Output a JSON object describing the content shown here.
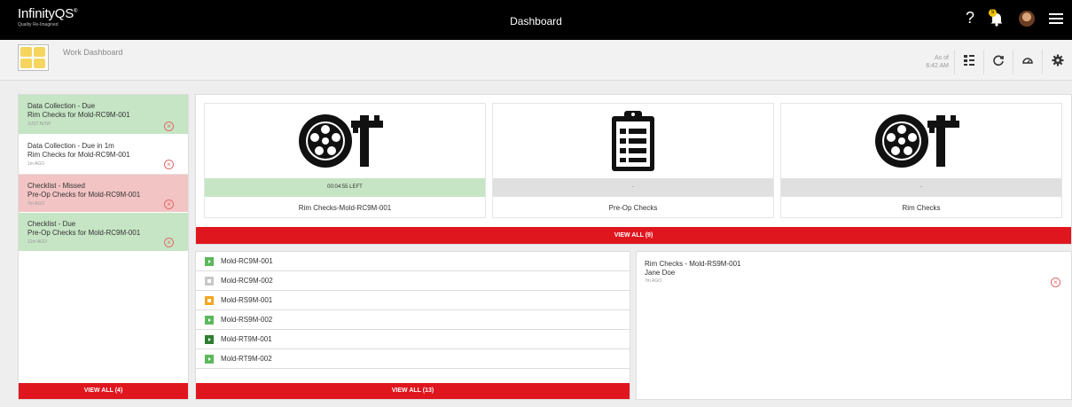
{
  "header": {
    "brand": "InfinityQS",
    "brand_mark": "®",
    "tagline": "Quality Re-Imagined",
    "title": "Dashboard",
    "help": "?",
    "notification_count": "5"
  },
  "toolbar": {
    "dashboard_name": "Work Dashboard",
    "as_of_label": "As of",
    "as_of_time": "6:42 AM"
  },
  "notifications": {
    "items": [
      {
        "title": "Data Collection - Due",
        "subject": "Rim Checks for Mold-RC9M-001",
        "ago": "JUST NOW",
        "color": "#c6e5c5"
      },
      {
        "title": "Data Collection - Due in 1m",
        "subject": "Rim Checks for Mold-RC9M-001",
        "ago": "1m AGO",
        "color": "#ffffff"
      },
      {
        "title": "Checklist - Missed",
        "subject": "Pre-Op Checks for Mold-RC9M-001",
        "ago": "7m AGO",
        "color": "#f3c4c4"
      },
      {
        "title": "Checklist - Due",
        "subject": "Pre-Op Checks for Mold-RC9M-001",
        "ago": "12m AGO",
        "color": "#c6e5c5"
      }
    ],
    "view_all": "VIEW ALL  (4)"
  },
  "cards": {
    "items": [
      {
        "icon": "wheel-caliper-icon",
        "status": "00:04:55 LEFT",
        "label": "Rim Checks-Mold-RC9M-001"
      },
      {
        "icon": "clipboard-checklist-icon",
        "status": "-",
        "label": "Pre-Op Checks"
      },
      {
        "icon": "wheel-caliper-icon",
        "status": "-",
        "label": "Rim Checks"
      }
    ],
    "view_all": "VIEW ALL (9)"
  },
  "molds": {
    "items": [
      {
        "name": "Mold-RC9M-001",
        "state_color": "#5cb85c"
      },
      {
        "name": "Mold-RC9M-002",
        "state_color": "#c8c8c8"
      },
      {
        "name": "Mold-RS9M-001",
        "state_color": "#f5a623"
      },
      {
        "name": "Mold-RS9M-002",
        "state_color": "#5cb85c"
      },
      {
        "name": "Mold-RT9M-001",
        "state_color": "#2e7d32"
      },
      {
        "name": "Mold-RT9M-002",
        "state_color": "#5cb85c"
      }
    ],
    "view_all": "VIEW ALL  (13)"
  },
  "event": {
    "title": "Rim Checks - Mold-RS9M-001",
    "user": "Jane Doe",
    "ago": "7m AGO"
  },
  "colors": {
    "accent_red": "#e0161e",
    "due_green": "#c6e5c5",
    "missed_red": "#f3c4c4"
  }
}
